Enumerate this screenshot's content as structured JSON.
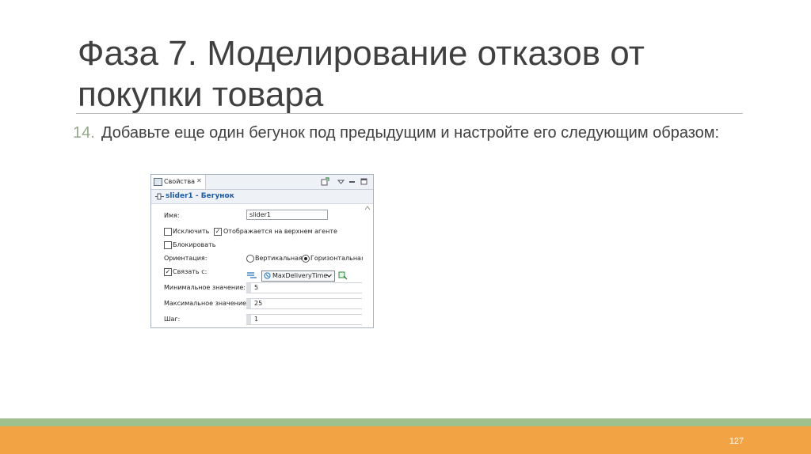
{
  "slide": {
    "title": "Фаза 7. Моделирование отказов от покупки товара",
    "item_number": "14.",
    "item_text": "Добавьте еще один бегунок под предыдущим и настройте его следующим образом:",
    "page_number": "127"
  },
  "panel": {
    "tab_label": "Свойства",
    "tab_close": "✕",
    "heading": "slider1 - Бегунок",
    "name_label": "Имя:",
    "name_value": "slider1",
    "exclude_label": "Исключить",
    "exclude_checked": false,
    "show_on_top_label": "Отображается на верхнем агенте",
    "show_on_top_checked": true,
    "lock_label": "Блокировать",
    "lock_checked": false,
    "orientation_label": "Ориентация:",
    "orientation_vertical": "Вертикальная",
    "orientation_horizontal": "Горизонтальная",
    "orientation_selected": "Горизонтальная",
    "link_label": "Связать с:",
    "link_checked": true,
    "link_value": "MaxDeliveryTime",
    "min_label": "Минимальное значение:",
    "min_value": "5",
    "max_label": "Максимальное значение:",
    "max_value": "25",
    "step_label": "Шаг:",
    "step_value": "1"
  },
  "icons": {
    "tab": "properties-icon",
    "heading": "slider-icon",
    "link_param": "parameter-icon",
    "link_add": "add-link-icon"
  },
  "colors": {
    "title_text": "#404040",
    "item_number": "#95a98a",
    "heading_text": "#1c5aa8",
    "footer_green": "#9fbf8d",
    "footer_orange": "#f2a344"
  }
}
